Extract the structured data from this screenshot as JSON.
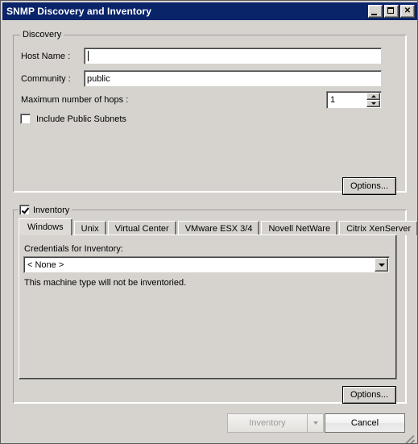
{
  "window": {
    "title": "SNMP Discovery and Inventory",
    "controls": [
      {
        "name": "minimize-button",
        "glyph": "minimize"
      },
      {
        "name": "maximize-button",
        "glyph": "maximize"
      },
      {
        "name": "close-button",
        "glyph": "close",
        "label": "✕"
      }
    ]
  },
  "discovery": {
    "legend": "Discovery",
    "host_name_label": "Host Name :",
    "host_name_value": "",
    "community_label": "Community :",
    "community_value": "public",
    "max_hops_label": "Maximum number of hops :",
    "max_hops_value": "1",
    "include_public_subnets_label": "Include Public Subnets",
    "include_public_subnets_checked": false,
    "options_button": "Options..."
  },
  "inventory": {
    "legend": "Inventory",
    "legend_checked": true,
    "tabs": [
      {
        "label": "Windows",
        "selected": true
      },
      {
        "label": "Unix",
        "selected": false
      },
      {
        "label": "Virtual Center",
        "selected": false
      },
      {
        "label": "VMware ESX 3/4",
        "selected": false
      },
      {
        "label": "Novell NetWare",
        "selected": false
      },
      {
        "label": "Citrix XenServer",
        "selected": false
      }
    ],
    "credentials_label": "Credentials for Inventory:",
    "credentials_value": "< None >",
    "note": "This machine type will not be inventoried.",
    "options_button": "Options..."
  },
  "footer": {
    "inventory_button": "Inventory",
    "inventory_button_disabled": true,
    "cancel_button": "Cancel"
  },
  "colors": {
    "titlebar": "#0a246a",
    "dialog_face": "#d6d3ce",
    "field_bg": "#ffffff",
    "disabled_text": "#9a9a9a"
  }
}
